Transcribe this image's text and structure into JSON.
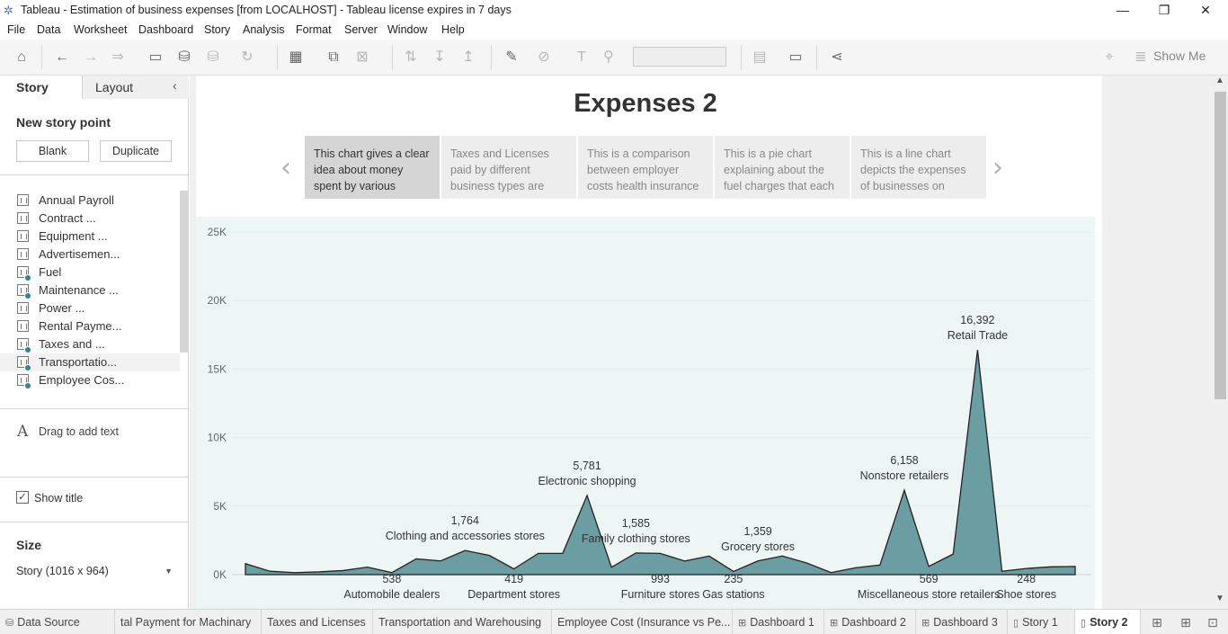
{
  "window": {
    "title": "Tableau - Estimation of business expenses [from LOCALHOST] - Tableau license expires in 7 days",
    "minimize": "—",
    "maximize": "❐",
    "close": "✕"
  },
  "menu": [
    "File",
    "Data",
    "Worksheet",
    "Dashboard",
    "Story",
    "Analysis",
    "Format",
    "Server",
    "Window",
    "Help"
  ],
  "toolbar": {
    "show_me": "Show Me"
  },
  "left_panel": {
    "tab_story": "Story",
    "tab_layout": "Layout",
    "collapse_icon": "‹",
    "new_story_point": "New story point",
    "blank_button": "Blank",
    "duplicate_button": "Duplicate",
    "sheets": [
      {
        "label": "Annual Payroll",
        "checked": false
      },
      {
        "label": "Contract ...",
        "checked": false
      },
      {
        "label": "Equipment ...",
        "checked": false
      },
      {
        "label": "Advertisemen...",
        "checked": false
      },
      {
        "label": "Fuel",
        "checked": true
      },
      {
        "label": "Maintenance ...",
        "checked": true
      },
      {
        "label": "Power ...",
        "checked": false
      },
      {
        "label": "Rental Payme...",
        "checked": false
      },
      {
        "label": "Taxes and ...",
        "checked": true
      },
      {
        "label": "Transportatio...",
        "checked": true
      },
      {
        "label": "Employee Cos...",
        "checked": true
      }
    ],
    "drag_text_icon": "A",
    "drag_text": "Drag to add text",
    "show_title_check": "✓",
    "show_title": "Show title",
    "size_heading": "Size",
    "size_value": "Story (1016 x 964)",
    "size_arrow": "▼"
  },
  "story": {
    "title": "Expenses 2",
    "prev_arrow": "‹",
    "next_arrow": "›",
    "points": [
      "This chart gives a clear idea about money spent by various",
      "Taxes and Licenses paid by different business types are",
      "This is a comparison between employer costs health insurance",
      "This is a pie chart explaining about the fuel charges that each",
      "This is a line chart depicts the expenses of businesses on"
    ]
  },
  "chart_data": {
    "type": "area",
    "title": "",
    "xlabel": "",
    "ylabel": "",
    "ylim": [
      0,
      25000
    ],
    "y_ticks": [
      "0K",
      "5K",
      "10K",
      "15K",
      "20K",
      "25K"
    ],
    "y_tick_values": [
      0,
      5000,
      10000,
      15000,
      20000,
      25000
    ],
    "fill_color": "#6a9ea3",
    "values": [
      800,
      250,
      150,
      200,
      300,
      550,
      150,
      1150,
      1000,
      1764,
      1400,
      419,
      1550,
      1550,
      5781,
      538,
      1585,
      1550,
      993,
      1359,
      235,
      1000,
      1359,
      850,
      150,
      500,
      700,
      6158,
      600,
      1500,
      16392,
      248,
      450,
      569,
      600
    ],
    "annotations": [
      {
        "index": 6,
        "value": "538",
        "label": "Automobile dealers",
        "position": "below"
      },
      {
        "index": 9,
        "value": "1,764",
        "label": "Clothing and accessories stores",
        "position": "above"
      },
      {
        "index": 11,
        "value": "419",
        "label": "Department stores",
        "position": "below"
      },
      {
        "index": 14,
        "value": "5,781",
        "label": "Electronic shopping",
        "position": "above"
      },
      {
        "index": 16,
        "value": "1,585",
        "label": "Family clothing stores",
        "position": "above"
      },
      {
        "index": 17,
        "value": "993",
        "label": "Furniture stores",
        "position": "below"
      },
      {
        "index": 20,
        "value": "235",
        "label": "Gas stations",
        "position": "below"
      },
      {
        "index": 21,
        "value": "1,359",
        "label": "Grocery stores",
        "position": "above"
      },
      {
        "index": 27,
        "value": "6,158",
        "label": "Nonstore retailers",
        "position": "above"
      },
      {
        "index": 28,
        "value": "569",
        "label": "Miscellaneous store retailers",
        "position": "below"
      },
      {
        "index": 30,
        "value": "16,392",
        "label": "Retail Trade",
        "position": "above"
      },
      {
        "index": 32,
        "value": "248",
        "label": "Shoe stores",
        "position": "below"
      }
    ]
  },
  "bottom_tabs": [
    {
      "label": "Data Source",
      "icon": "⛁",
      "active": false
    },
    {
      "label": "tal Payment for Machinary",
      "icon": "",
      "active": false
    },
    {
      "label": "Taxes and Licenses",
      "icon": "",
      "active": false
    },
    {
      "label": "Transportation and Warehousing",
      "icon": "",
      "active": false
    },
    {
      "label": "Employee Cost (Insurance vs Pe...",
      "icon": "",
      "active": false
    },
    {
      "label": "Dashboard 1",
      "icon": "⊞",
      "active": false
    },
    {
      "label": "Dashboard 2",
      "icon": "⊞",
      "active": false
    },
    {
      "label": "Dashboard 3",
      "icon": "⊞",
      "active": false
    },
    {
      "label": "Story 1",
      "icon": "▯",
      "active": false
    },
    {
      "label": "Story 2",
      "icon": "▯",
      "active": true
    }
  ]
}
